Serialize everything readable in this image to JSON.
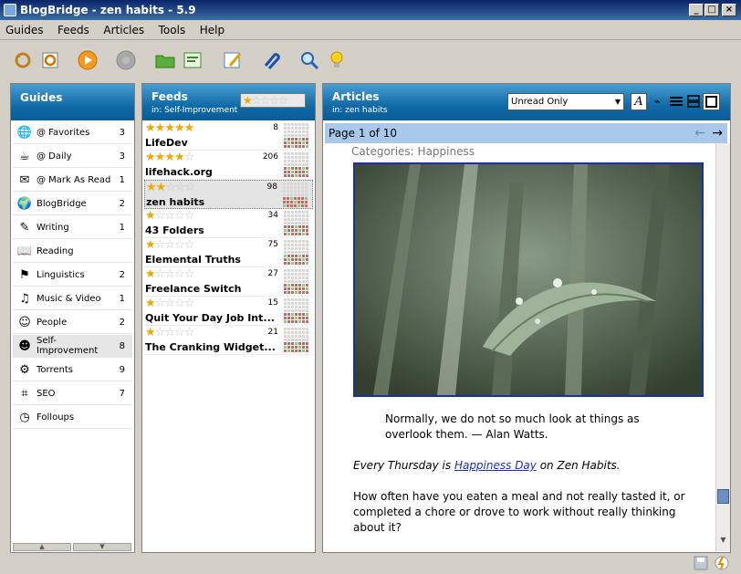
{
  "window": {
    "title": "BlogBridge - zen habits - 5.9"
  },
  "menu": [
    "Guides",
    "Feeds",
    "Articles",
    "Tools",
    "Help"
  ],
  "toolbar": {
    "icons": [
      "update-icon",
      "sync-icon",
      "play-icon",
      "stop-icon",
      "open-folder-icon",
      "new-feed-icon",
      "edit-icon",
      "attach-icon",
      "search-icon",
      "tip-icon"
    ]
  },
  "guides": {
    "title": "Guides",
    "items": [
      {
        "label": "@ Favorites",
        "count": "3",
        "icon": "globe-icon"
      },
      {
        "label": "@ Daily",
        "count": "3",
        "icon": "coffee-icon"
      },
      {
        "label": "@ Mark As Read",
        "count": "1",
        "icon": "mark-read-icon"
      },
      {
        "label": "BlogBridge",
        "count": "2",
        "icon": "blogbridge-icon"
      },
      {
        "label": "Writing",
        "count": "1",
        "icon": "pen-icon"
      },
      {
        "label": "Reading",
        "count": "",
        "icon": "book-icon"
      },
      {
        "label": "Linguistics",
        "count": "2",
        "icon": "flag-icon"
      },
      {
        "label": "Music & Video",
        "count": "1",
        "icon": "music-icon"
      },
      {
        "label": "People",
        "count": "2",
        "icon": "people-icon"
      },
      {
        "label": "Self-Improvement",
        "count": "8",
        "icon": "person-icon"
      },
      {
        "label": "Torrents",
        "count": "9",
        "icon": "gear-icon"
      },
      {
        "label": "SEO",
        "count": "7",
        "icon": "seo-icon"
      },
      {
        "label": "Folloups",
        "count": "",
        "icon": "clock-icon"
      }
    ]
  },
  "feeds": {
    "title": "Feeds",
    "subtitle": "in: Self-Improvement",
    "filter_rating": 1,
    "items": [
      {
        "name": "LifeDev",
        "count": "8",
        "rating": 5
      },
      {
        "name": "lifehack.org",
        "count": "206",
        "rating": 4
      },
      {
        "name": "zen habits",
        "count": "98",
        "rating": 2
      },
      {
        "name": "43 Folders",
        "count": "34",
        "rating": 1
      },
      {
        "name": "Elemental Truths",
        "count": "75",
        "rating": 1
      },
      {
        "name": "Freelance Switch",
        "count": "27",
        "rating": 1
      },
      {
        "name": "Quit Your Day Job Int...",
        "count": "15",
        "rating": 1
      },
      {
        "name": "The Cranking Widget...",
        "count": "21",
        "rating": 1
      }
    ]
  },
  "articles": {
    "title": "Articles",
    "subtitle": "in: zen habits",
    "filter": "Unread Only",
    "page": "Page 1 of 10",
    "categories": "Categories: Happiness",
    "quote": "Normally, we do not so much look at things as overlook them. — Alan Watts.",
    "p1_prefix": "Every Thursday is ",
    "p1_link": "Happiness Day",
    "p1_suffix": " on Zen Habits.",
    "p2": "How often have you eaten a meal and not really tasted it, or completed a chore or drove to work without really thinking about it?"
  },
  "colors": {
    "header": "#0f6aa8",
    "pagebar": "#a8c8ec",
    "star": "#f2a800"
  }
}
